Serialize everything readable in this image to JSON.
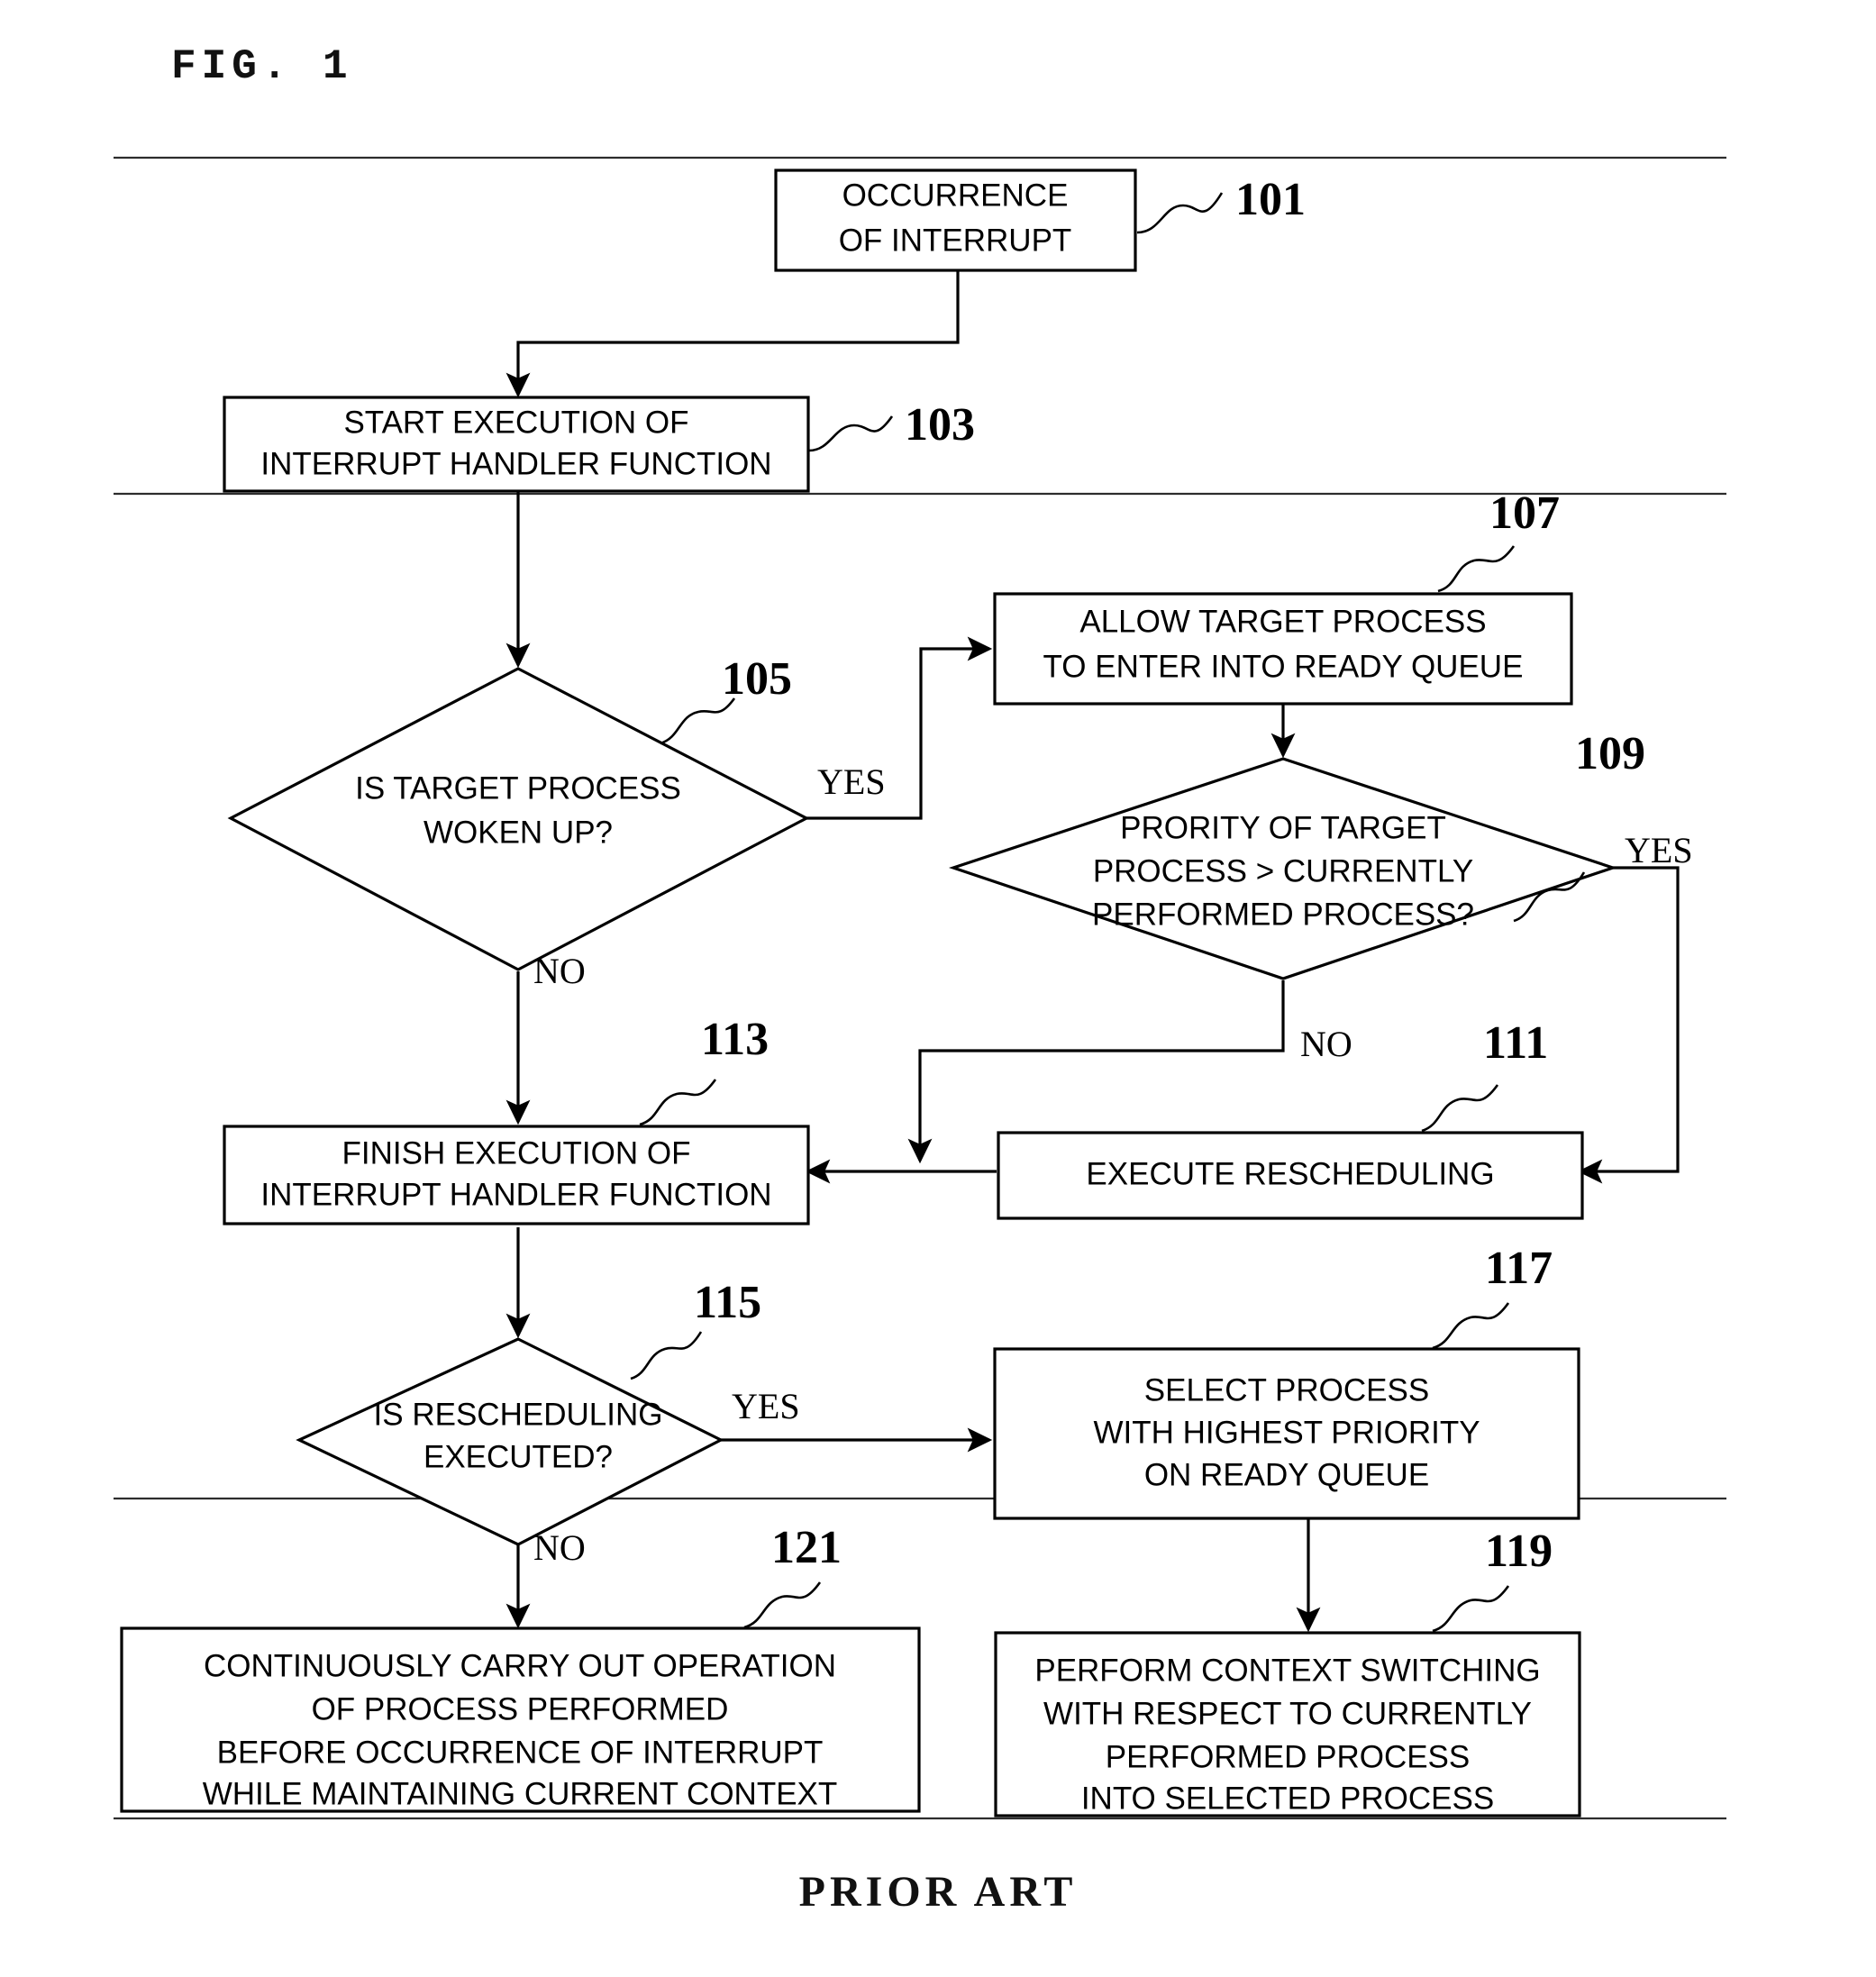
{
  "figure": {
    "label": "FIG. 1",
    "footer": "PRIOR ART"
  },
  "diagram": {
    "type": "flowchart",
    "nodes": [
      {
        "id": "101",
        "ref": "101",
        "shape": "process",
        "lines": [
          "OCCURRENCE",
          "OF INTERRUPT"
        ]
      },
      {
        "id": "103",
        "ref": "103",
        "shape": "process",
        "lines": [
          "START EXECUTION OF",
          "INTERRUPT HANDLER FUNCTION"
        ]
      },
      {
        "id": "105",
        "ref": "105",
        "shape": "decision",
        "lines": [
          "IS TARGET PROCESS",
          "WOKEN UP?"
        ]
      },
      {
        "id": "107",
        "ref": "107",
        "shape": "process",
        "lines": [
          "ALLOW TARGET PROCESS",
          "TO ENTER INTO READY QUEUE"
        ]
      },
      {
        "id": "109",
        "ref": "109",
        "shape": "decision",
        "lines": [
          "PRORITY OF TARGET",
          "PROCESS  > CURRENTLY",
          "PERFORMED PROCESS?"
        ]
      },
      {
        "id": "111",
        "ref": "111",
        "shape": "process",
        "lines": [
          "EXECUTE RESCHEDULING"
        ]
      },
      {
        "id": "113",
        "ref": "113",
        "shape": "process",
        "lines": [
          "FINISH EXECUTION OF",
          "INTERRUPT HANDLER FUNCTION"
        ]
      },
      {
        "id": "115",
        "ref": "115",
        "shape": "decision",
        "lines": [
          "IS RESCHEDULING",
          "EXECUTED?"
        ]
      },
      {
        "id": "117",
        "ref": "117",
        "shape": "process",
        "lines": [
          "SELECT PROCESS",
          "WITH HIGHEST PRIORITY",
          "ON READY QUEUE"
        ]
      },
      {
        "id": "119",
        "ref": "119",
        "shape": "process",
        "lines": [
          "PERFORM CONTEXT SWITCHING",
          "WITH RESPECT TO CURRENTLY",
          "PERFORMED PROCESS",
          "INTO SELECTED PROCESS"
        ]
      },
      {
        "id": "121",
        "ref": "121",
        "shape": "process",
        "lines": [
          "CONTINUOUSLY CARRY OUT OPERATION",
          "OF PROCESS PERFORMED",
          "BEFORE OCCURRENCE OF INTERRUPT",
          "WHILE MAINTAINING CURRENT CONTEXT"
        ]
      }
    ],
    "branch_labels": {
      "yes_105": "YES",
      "no_105": "NO",
      "yes_109": "YES",
      "no_109": "NO",
      "yes_115": "YES",
      "no_115": "NO"
    },
    "edges": [
      {
        "from": "101",
        "to": "103",
        "label": ""
      },
      {
        "from": "103",
        "to": "105",
        "label": ""
      },
      {
        "from": "105",
        "to": "107",
        "label": "YES"
      },
      {
        "from": "105",
        "to": "113",
        "label": "NO"
      },
      {
        "from": "107",
        "to": "109",
        "label": ""
      },
      {
        "from": "109",
        "to": "111",
        "label": "YES"
      },
      {
        "from": "109",
        "to": "113",
        "label": "NO"
      },
      {
        "from": "111",
        "to": "113",
        "label": ""
      },
      {
        "from": "113",
        "to": "115",
        "label": ""
      },
      {
        "from": "115",
        "to": "117",
        "label": "YES"
      },
      {
        "from": "115",
        "to": "121",
        "label": "NO"
      },
      {
        "from": "117",
        "to": "119",
        "label": ""
      }
    ],
    "colors": {
      "stroke": "#000000",
      "fill": "#ffffff",
      "text": "#000000"
    }
  }
}
